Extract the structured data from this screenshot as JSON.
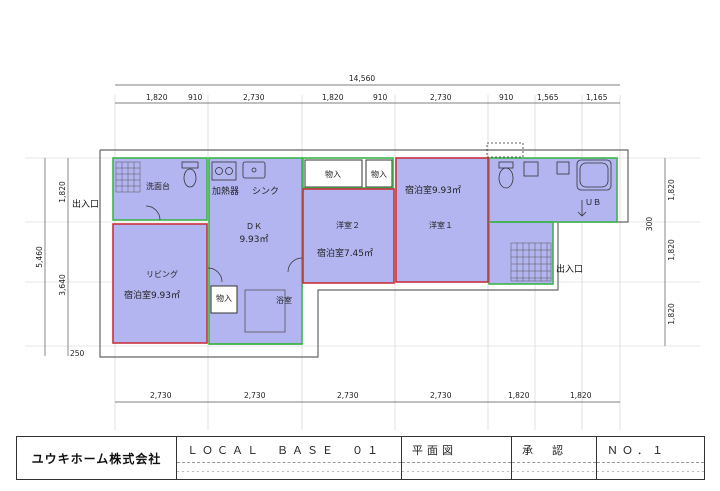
{
  "dimensions": {
    "overall_top": "14,560",
    "top_segments": [
      "1,820",
      "910",
      "2,730",
      "1,820",
      "910",
      "2,730",
      "910",
      "1,565",
      "1,165"
    ],
    "bottom_segments": [
      "2,730",
      "2,730",
      "2,730",
      "2,730",
      "1,820",
      "1,820"
    ],
    "left_overall": "5,460",
    "left_segments": [
      "1,820",
      "3,640",
      "250"
    ],
    "right_segments": [
      "1,820",
      "300",
      "1,820",
      "1,820"
    ]
  },
  "rooms": {
    "washroom": "洗面台",
    "heater": "加熱器",
    "sink": "シンク",
    "dk": "ＤＫ",
    "dk_area": "9.93㎡",
    "closet_top1": "物入",
    "closet_top2": "物入",
    "closet_lower": "物入",
    "bath": "浴室",
    "western2": "洋室２",
    "lodging2": "宿泊室7.45㎡",
    "western1": "洋室１",
    "lodging1": "宿泊室9.93㎡",
    "living": "リビング",
    "lodging_living": "宿泊室9.93㎡",
    "ub": "ＵＢ"
  },
  "entrances": {
    "left": "出入口",
    "right": "出入口"
  },
  "title_block": {
    "company": "ユウキホーム株式会社",
    "project": "ＬＯＣＡＬ　ＢＡＳＥ　０１",
    "drawing": "平面図",
    "approval": "承　認",
    "number": "ＮＯ．１"
  },
  "colors": {
    "room_fill": "#b3b5f0",
    "green_wall": "#3cb54a",
    "red_wall": "#c8323c",
    "line": "#444444"
  }
}
